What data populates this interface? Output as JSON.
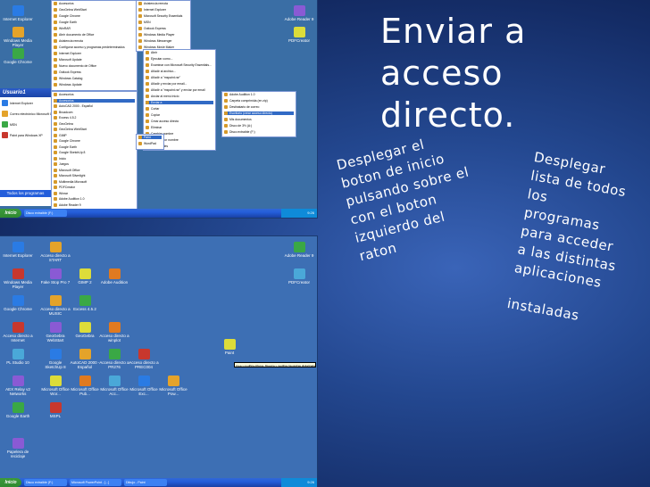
{
  "slide": {
    "title": "Enviar a\nacceso\ndirecto.",
    "note_left": "Desplegar el\nboton de inicio\npulsando sobre el\ncon el boton\nizquierdo del\nraton",
    "note_right": "Desplegar\nlista de todos\nlos\nprogramas\npara acceder\na las distintas\naplicaciones",
    "note_extra": "instaladas"
  },
  "screenshot1": {
    "desktop_icons_left": [
      "Internet Explorer",
      "Windows Media Player",
      "Google Chrome"
    ],
    "desktop_icons_right": [
      "Adobe Reader 9",
      "PDFCreator"
    ],
    "start_menu": {
      "user": "Usuario1",
      "pinned": [
        "Internet Explorer",
        "Correo electrónico Microsoft Office Outlook",
        "MSN",
        "Paint para Windows XP"
      ],
      "all_programs": "Todos los programas"
    },
    "programs_col1": [
      "Accesorios",
      "GeoGebra WebStart",
      "Google Chrome",
      "Google Earth",
      "WinRAR",
      "Abrir documento de Office",
      "Asistencia remota",
      "Configurar acceso y programas predeterminados",
      "Internet Explorer",
      "Microsoft Update",
      "Nuevo documento de Office",
      "Outlook Express",
      "Windows Catalog",
      "Windows Update"
    ],
    "programs_col2": [
      "Asistencia remota",
      "Internet Explorer",
      "Microsoft Security Essentials",
      "MSN",
      "Outlook Express",
      "Windows Media Player",
      "Windows Messenger",
      "Windows Movie Maker"
    ],
    "context_menu": [
      "Abrir",
      "Ejecutar como...",
      "Examinar con Microsoft Security Essentials...",
      "Añadir al archivo...",
      "Añadir a \"mspaint.rar\"",
      "Añadir y enviar por email...",
      "Añadir a \"mspaint.rar\" y enviar por email",
      "Anclar al menú Inicio",
      "Enviar a",
      "Cortar",
      "Copiar",
      "Crear acceso directo",
      "Eliminar",
      "Cambiar nombre",
      "Ordenar por nombre",
      "Propiedades"
    ],
    "send_to_menu": [
      "Adobe Audition 1.0",
      "Carpeta comprimida (en zip)",
      "Destinatario de correo",
      "Escritorio (crear acceso directo)",
      "Mis documentos",
      "Disco de 3½ (A:)",
      "Disco extraíble (F:)"
    ],
    "programs_list": [
      "Accesorios",
      "Accesorios",
      "AutoCAD 2000 - Español",
      "Broadcom",
      "Excess 4.5.2",
      "GeoGebra",
      "GeoGebra WebStart",
      "GIMP",
      "Google Chrome",
      "Google Earth",
      "Google SketchUp 8",
      "Inicio",
      "Juegos",
      "Microsoft Office",
      "Microsoft Silverlight",
      "Multimedia Microsoft",
      "PDFCreator",
      "Winrar",
      "Adobe Audition 1.0",
      "Adobe Reader 9"
    ],
    "paint_items": [
      "Paint",
      "WordPad"
    ],
    "taskbar": {
      "start": "Inicio",
      "item": "Disco extraíble (F:)",
      "clock": "9:26"
    }
  },
  "screenshot2": {
    "icons": [
      {
        "label": "Internet Explorer"
      },
      {
        "label": "Acceso directo a START"
      },
      {
        "label": "Adobe Reader 9"
      },
      {
        "label": "Windows Media Player"
      },
      {
        "label": "Fake Stop Pro 7"
      },
      {
        "label": "GIMP 2"
      },
      {
        "label": "Adobe Audition"
      },
      {
        "label": "PDFCreator"
      },
      {
        "label": "Google Chrome"
      },
      {
        "label": "Acceso directo a MUSIC"
      },
      {
        "label": "Excess 4.5.2"
      },
      {
        "label": "Acceso directo a Internet"
      },
      {
        "label": "GeoGebra WebStart"
      },
      {
        "label": "GeoGebra"
      },
      {
        "label": "Acceso directo a winplot"
      },
      {
        "label": "PL Studio 10"
      },
      {
        "label": "Google SketchUp 8"
      },
      {
        "label": "AutoCAD 2000 - Español"
      },
      {
        "label": "Acceso directo a PR276"
      },
      {
        "label": "Acceso directo a PREC004"
      },
      {
        "label": "AEX Relay v2 Networks"
      },
      {
        "label": "Microsoft Office Wor..."
      },
      {
        "label": "Microsoft Office Pub..."
      },
      {
        "label": "Microsoft Office Acc..."
      },
      {
        "label": "Microsoft Office Exc..."
      },
      {
        "label": "Microsoft Office Pow..."
      },
      {
        "label": "Google Earth"
      },
      {
        "label": "MSPL"
      },
      {
        "label": "Papelera de reciclaje"
      },
      {
        "label": "Paint"
      }
    ],
    "tooltip": "Crea y modifica dibujos. Muestra y modifica fotografías digitalizadas.",
    "taskbar": {
      "start": "Inicio",
      "items": [
        "Disco extraíble (F:)",
        "Microsoft PowerPoint - [...]",
        "Dibujo - Paint"
      ],
      "clock": "9:26"
    }
  }
}
